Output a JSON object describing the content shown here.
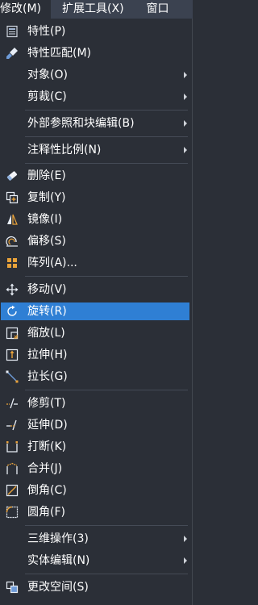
{
  "menubar": {
    "items": [
      "修改(M)",
      "扩展工具(X)",
      "窗口"
    ]
  },
  "menu": {
    "items": [
      {
        "label": "特性(P)",
        "icon": "properties-icon"
      },
      {
        "label": "特性匹配(M)",
        "icon": "match-properties-brush-icon"
      },
      {
        "label": "对象(O)",
        "submenu": true
      },
      {
        "label": "剪裁(C)",
        "submenu": true
      },
      {
        "label": "外部参照和块编辑(B)",
        "submenu": true
      },
      {
        "label": "注释性比例(N)",
        "submenu": true
      },
      {
        "label": "删除(E)",
        "icon": "erase-icon"
      },
      {
        "label": "复制(Y)",
        "icon": "copy-icon"
      },
      {
        "label": "镜像(I)",
        "icon": "mirror-icon"
      },
      {
        "label": "偏移(S)",
        "icon": "offset-icon"
      },
      {
        "label": "阵列(A)...",
        "icon": "array-icon"
      },
      {
        "label": "移动(V)",
        "icon": "move-icon"
      },
      {
        "label": "旋转(R)",
        "icon": "rotate-icon",
        "highlighted": true
      },
      {
        "label": "缩放(L)",
        "icon": "scale-icon"
      },
      {
        "label": "拉伸(H)",
        "icon": "stretch-icon"
      },
      {
        "label": "拉长(G)",
        "icon": "lengthen-icon"
      },
      {
        "label": "修剪(T)",
        "icon": "trim-icon"
      },
      {
        "label": "延伸(D)",
        "icon": "extend-icon"
      },
      {
        "label": "打断(K)",
        "icon": "break-icon"
      },
      {
        "label": "合并(J)",
        "icon": "join-icon"
      },
      {
        "label": "倒角(C)",
        "icon": "chamfer-icon"
      },
      {
        "label": "圆角(F)",
        "icon": "fillet-icon"
      },
      {
        "label": "三维操作(3)",
        "submenu": true
      },
      {
        "label": "实体编辑(N)",
        "submenu": true
      },
      {
        "label": "更改空间(S)",
        "icon": "change-space-icon"
      }
    ]
  },
  "colors": {
    "menu_background": "#2b2f37",
    "menubar_background": "#3b4250",
    "highlight": "#2f7fd4",
    "separator": "#454b56",
    "text": "#ffffff"
  }
}
